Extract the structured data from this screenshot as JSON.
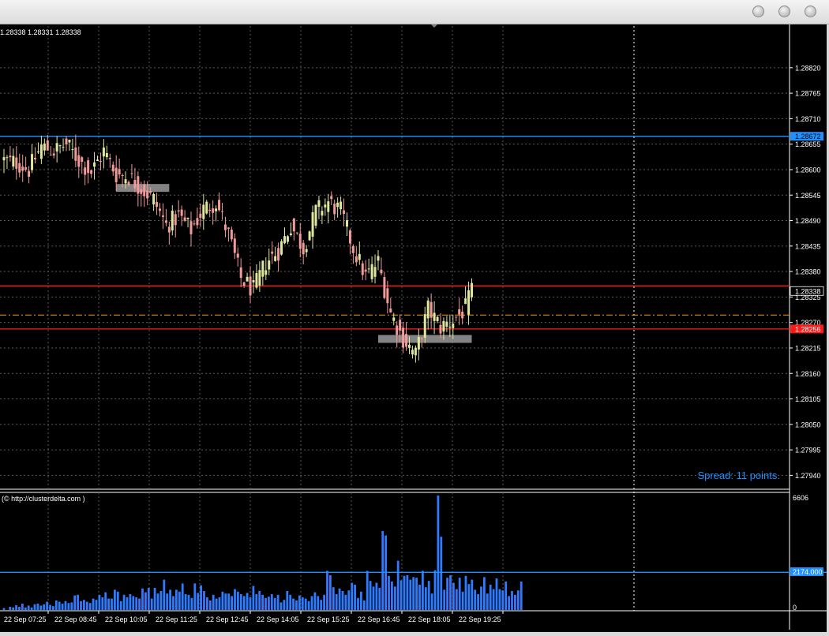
{
  "window": {
    "buttons": [
      "minimize",
      "maximize",
      "close"
    ]
  },
  "price_panel": {
    "ohlc_header": "1.28338 1.28331 1.28338",
    "spread_text": "Spread: 11 points.",
    "colors": {
      "bull": "#dfe79c",
      "bear": "#f19a9a",
      "grid": "#5a5a5a",
      "blue_line": "#1e90ff",
      "red_line": "#ff1a1a",
      "dashdot_line": "#ff9a00"
    },
    "price_labels": [
      {
        "text": "1.28672",
        "color": "#1e90ff",
        "price": 1.28672
      },
      {
        "text": "1.28338",
        "color": "#ffffff",
        "price": 1.28338
      },
      {
        "text": "1.28256",
        "color": "#ff1a1a",
        "price": 1.28256
      }
    ]
  },
  "volume_panel": {
    "label": "(© http://clusterdelta.com )",
    "max_label": "6606",
    "min_label": "0",
    "level_label": "2174.000"
  },
  "chart_data": [
    {
      "type": "candlestick",
      "title": "",
      "ylim": [
        1.2791,
        1.2891
      ],
      "y_ticks": [
        "1.28820",
        "1.28765",
        "1.28710",
        "1.28655",
        "1.28600",
        "1.28545",
        "1.28490",
        "1.28435",
        "1.28380",
        "1.28325",
        "1.28270",
        "1.28215",
        "1.28160",
        "1.28105",
        "1.28050",
        "1.27995",
        "1.27940"
      ],
      "x_ticks": [
        "22 Sep 07:25",
        "22 Sep 08:45",
        "22 Sep 10:05",
        "22 Sep 11:25",
        "22 Sep 12:45",
        "22 Sep 14:05",
        "22 Sep 15:25",
        "22 Sep 16:45",
        "22 Sep 18:05",
        "22 Sep 19:25"
      ],
      "horizontal_levels": [
        {
          "price": 1.28672,
          "color": "#1e90ff",
          "style": "solid"
        },
        {
          "price": 1.28349,
          "color": "#ff1a1a",
          "style": "solid"
        },
        {
          "price": 1.28286,
          "color": "#ff9a00",
          "style": "dash-dot"
        },
        {
          "price": 1.28256,
          "color": "#ff1a1a",
          "style": "solid"
        }
      ],
      "zones": [
        {
          "from_bar": 36,
          "to_bar": 53,
          "top": 1.28569,
          "bottom": 1.28552
        },
        {
          "from_bar": 120,
          "to_bar": 150,
          "top": 1.28243,
          "bottom": 1.28226
        }
      ],
      "close_anchors": [
        [
          0,
          1.2862
        ],
        [
          4,
          1.28615
        ],
        [
          8,
          1.286
        ],
        [
          12,
          1.2865
        ],
        [
          16,
          1.2864
        ],
        [
          20,
          1.28655
        ],
        [
          24,
          1.2862
        ],
        [
          28,
          1.28595
        ],
        [
          32,
          1.2864
        ],
        [
          36,
          1.2859
        ],
        [
          40,
          1.28585
        ],
        [
          44,
          1.2856
        ],
        [
          48,
          1.28535
        ],
        [
          52,
          1.2848
        ],
        [
          56,
          1.285
        ],
        [
          60,
          1.2847
        ],
        [
          64,
          1.28515
        ],
        [
          68,
          1.2853
        ],
        [
          72,
          1.2846
        ],
        [
          76,
          1.28365
        ],
        [
          80,
          1.2834
        ],
        [
          84,
          1.284
        ],
        [
          88,
          1.28425
        ],
        [
          92,
          1.2848
        ],
        [
          96,
          1.2843
        ],
        [
          100,
          1.2851
        ],
        [
          104,
          1.2853
        ],
        [
          108,
          1.2851
        ],
        [
          112,
          1.2843
        ],
        [
          116,
          1.2837
        ],
        [
          120,
          1.284
        ],
        [
          124,
          1.2829
        ],
        [
          128,
          1.28235
        ],
        [
          132,
          1.282
        ],
        [
          136,
          1.283
        ],
        [
          140,
          1.2826
        ],
        [
          144,
          1.28275
        ],
        [
          148,
          1.283
        ],
        [
          150,
          1.28338
        ]
      ]
    },
    {
      "type": "bar",
      "title": "",
      "ylim": [
        0,
        6606
      ],
      "reference_line": 2174,
      "values": [
        110,
        0,
        182,
        146,
        273,
        182,
        365,
        146,
        255,
        146,
        328,
        364,
        255,
        328,
        474,
        292,
        219,
        547,
        474,
        365,
        510,
        401,
        437,
        838,
        875,
        510,
        583,
        474,
        401,
        656,
        583,
        875,
        729,
        1021,
        656,
        656,
        1167,
        1057,
        510,
        875,
        729,
        911,
        802,
        729,
        656,
        1240,
        1021,
        1275,
        656,
        1276,
        948,
        1094,
        1750,
        948,
        1167,
        802,
        1167,
        1057,
        1531,
        911,
        875,
        693,
        1532,
        984,
        1423,
        1094,
        729,
        547,
        875,
        656,
        729,
        1057,
        948,
        948,
        802,
        1203,
        1057,
        911,
        802,
        984,
        729,
        1386,
        911,
        1094,
        875,
        693,
        766,
        911,
        692,
        875,
        437,
        583,
        1094,
        875,
        656,
        547,
        838,
        729,
        656,
        510,
        802,
        1020,
        802,
        583,
        874,
        2260,
        2005,
        1312,
        911,
        1239,
        1094,
        875,
        1130,
        1568,
        1458,
        692,
        1057,
        547,
        2260,
        1677,
        1349,
        1568,
        1276,
        4556,
        4301,
        1969,
        1641,
        1349,
        2843,
        1713,
        1969,
        2005,
        1750,
        1896,
        1859,
        1458,
        2260,
        1312,
        1677,
        948,
        2296,
        6606,
        4227,
        1166,
        1859,
        2005,
        1568,
        1203,
        1859,
        1057,
        1968,
        1495,
        1750,
        1166,
        911,
        1349,
        1896,
        947,
        1458,
        1203,
        1823,
        1203,
        1130,
        1640,
        802,
        1094,
        875,
        1130,
        1641
      ]
    }
  ]
}
